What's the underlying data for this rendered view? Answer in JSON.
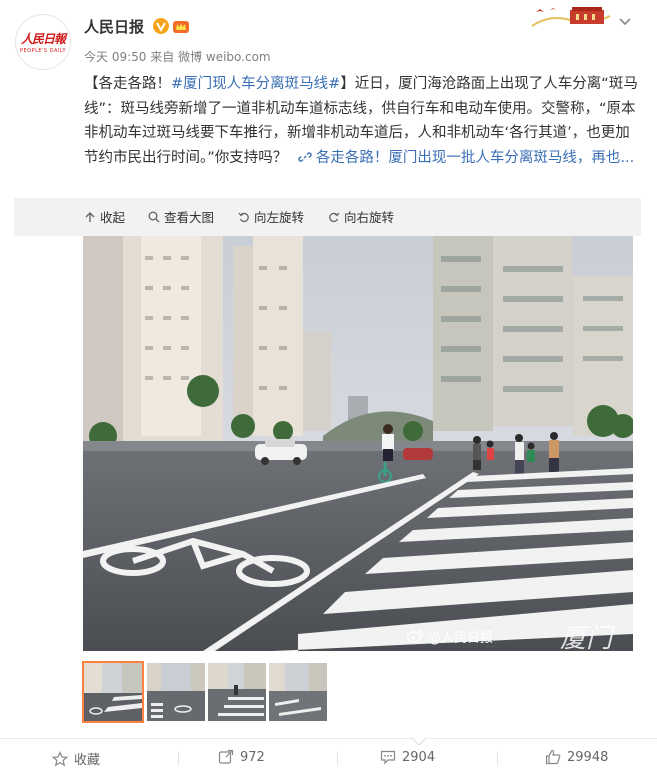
{
  "header": {
    "username": "人民日报",
    "time": "今天 09:50",
    "source_prefix": "来自",
    "source": "微博 weibo.com",
    "avatar_logo": "人民日報",
    "avatar_sub": "PEOPLE'S DAILY"
  },
  "post": {
    "open_bracket": "【各走各路！",
    "hashtag": "#厦门现人车分离斑马线#",
    "body": "】近日，厦门海沧路面上出现了人车分离“斑马线”：斑马线旁新增了一道非机动车道标志线，供自行车和电动车使用。交警称，“原本非机动车过斑马线要下车推行，新增非机动车道后，人和非机动车‘各行其道’，也更加节约市民出行时间。”你支持吗？",
    "link": "各走各路！厦门出现一批人车分离斑马线，再也..."
  },
  "toolbar": {
    "collapse": "收起",
    "view_large": "查看大图",
    "rotate_left": "向左旋转",
    "rotate_right": "向右旋转"
  },
  "photo": {
    "watermark_weibo": "@人民日报",
    "watermark_paper": "厦门晚报"
  },
  "actions": {
    "favorite": "收藏",
    "repost_count": "972",
    "comment_count": "2904",
    "like_count": "29948"
  },
  "colors": {
    "accent_link": "#3b6fb5",
    "selected_thumb": "#ff8140",
    "brand_red": "#d21a1a"
  }
}
